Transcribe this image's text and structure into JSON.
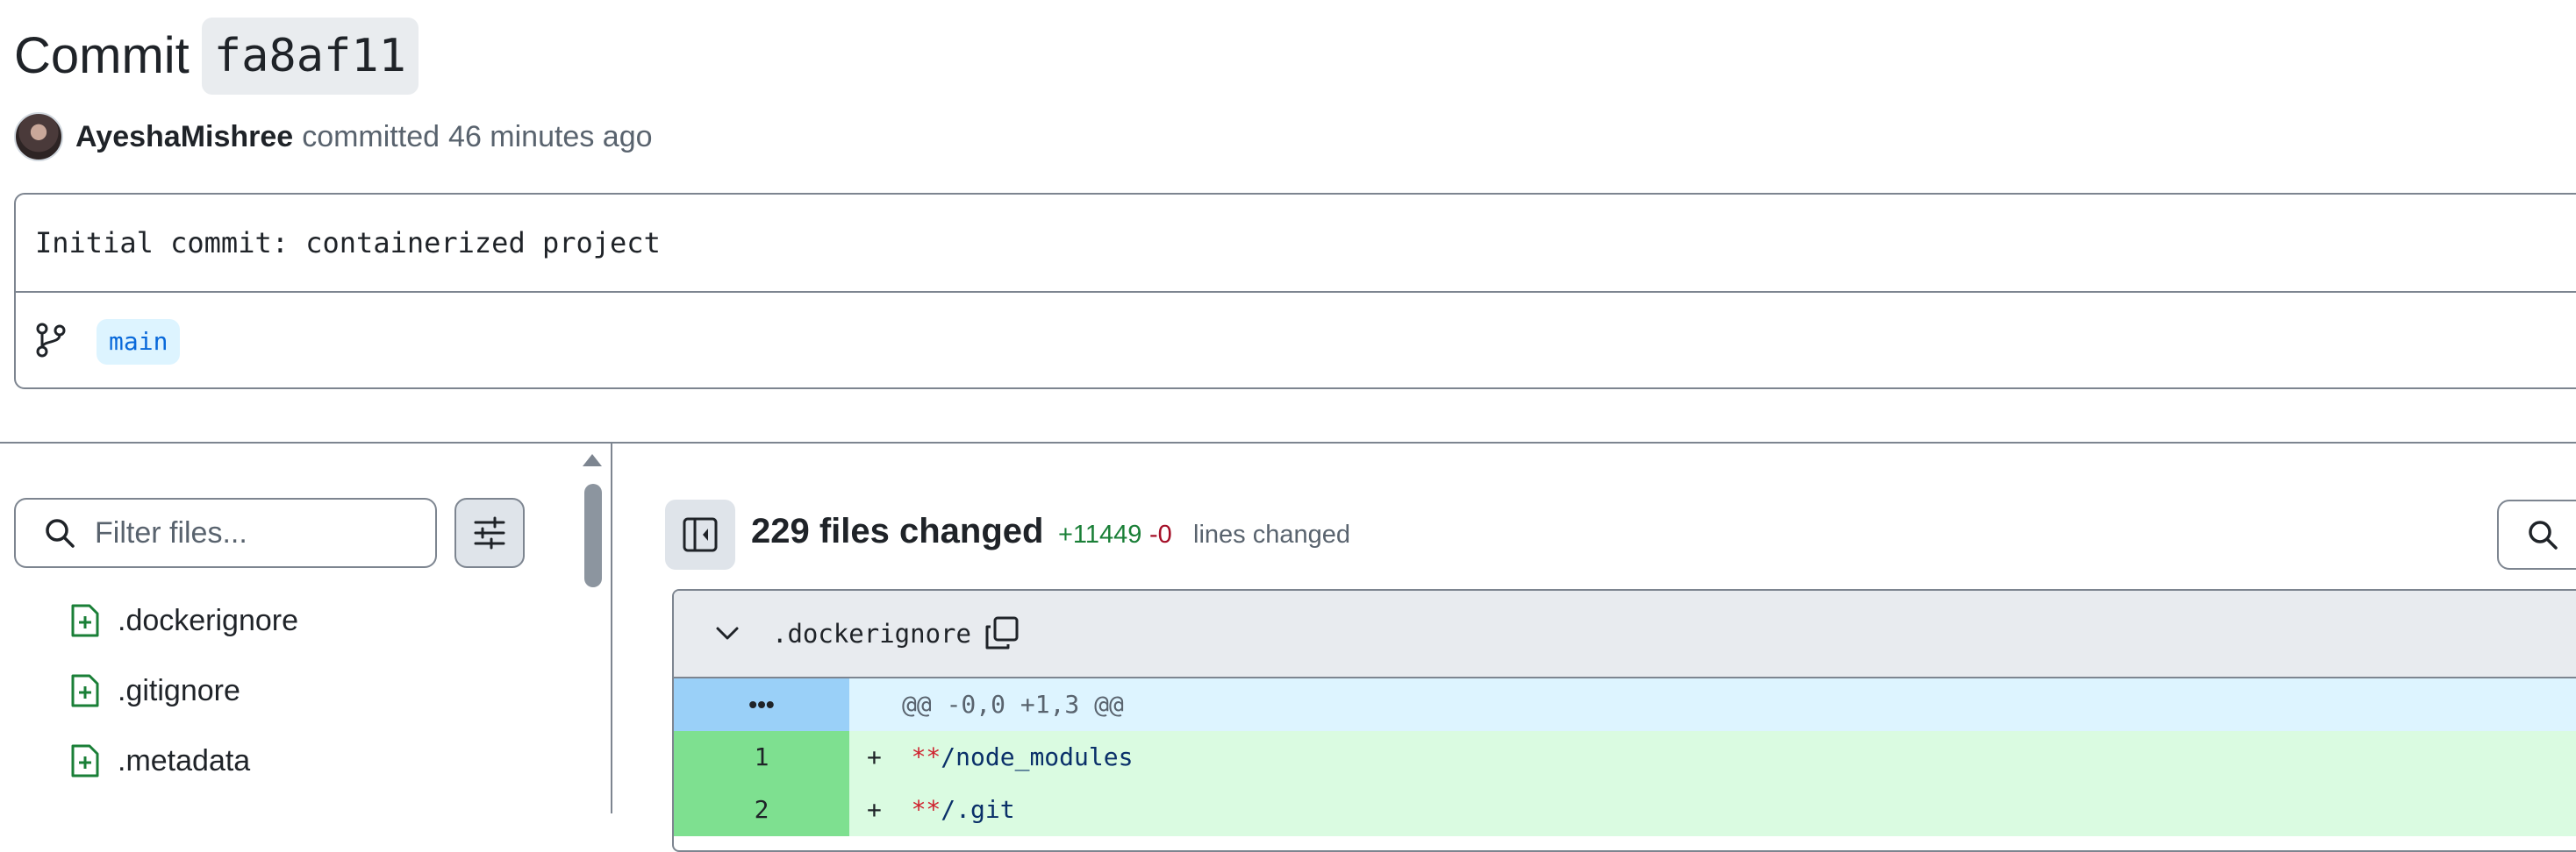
{
  "commit": {
    "label": "Commit",
    "sha": "fa8af11",
    "author": "AyeshaMishree",
    "action": "committed",
    "time": "46 minutes ago",
    "message": "Initial commit: containerized project",
    "branch": "main"
  },
  "filter": {
    "placeholder": "Filter files..."
  },
  "file_tree": [
    {
      "name": ".dockerignore",
      "status": "added"
    },
    {
      "name": ".gitignore",
      "status": "added"
    },
    {
      "name": ".metadata",
      "status": "added"
    }
  ],
  "summary": {
    "files_changed": "229 files changed",
    "additions": "+11449",
    "deletions": "-0",
    "lines_changed": "lines changed"
  },
  "diff": {
    "filename": ".dockerignore",
    "hunk_expand": "•••",
    "hunk_header": "@@ -0,0 +1,3 @@",
    "lines": [
      {
        "num": "1",
        "sign": "+",
        "stars": "**",
        "rest": "/node_modules"
      },
      {
        "num": "2",
        "sign": "+",
        "stars": "**",
        "rest": "/.git"
      }
    ]
  },
  "icons": {
    "branch": "git-branch-icon",
    "search": "search-icon",
    "settings": "sliders-icon",
    "toggle": "sidebar-toggle-icon",
    "chevron": "chevron-down-icon",
    "copy": "copy-icon",
    "file": "file-added-icon"
  },
  "colors": {
    "added": "#1a7f37",
    "deleted": "#a40e26",
    "branch_bg": "#ddf4ff",
    "hunk_gutter": "#9ad0f8",
    "add_gutter": "#7ee090",
    "add_bg": "#dafbe1"
  }
}
